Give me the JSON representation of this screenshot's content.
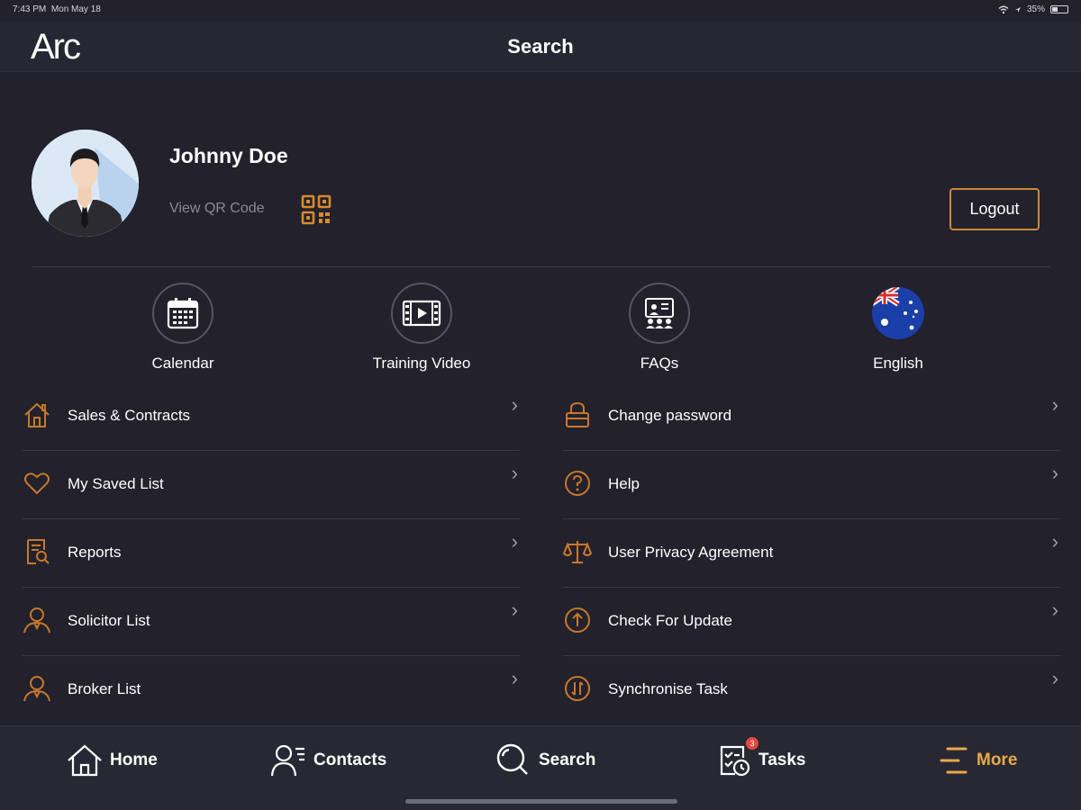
{
  "status_bar": {
    "time": "7:43 PM",
    "date": "Mon May 18",
    "battery": "35%"
  },
  "app": {
    "logo": "Arc",
    "title": "Search"
  },
  "profile": {
    "name": "Johnny Doe",
    "qr_label": "View QR Code",
    "logout_label": "Logout"
  },
  "quick_actions": [
    {
      "label": "Calendar",
      "icon": "calendar-icon"
    },
    {
      "label": "Training Video",
      "icon": "video-icon"
    },
    {
      "label": "FAQs",
      "icon": "faq-icon"
    },
    {
      "label": "English",
      "icon": "australia-flag-icon"
    }
  ],
  "menu_left": [
    {
      "label": "Sales & Contracts",
      "icon": "house-icon"
    },
    {
      "label": "My Saved List",
      "icon": "heart-icon"
    },
    {
      "label": "Reports",
      "icon": "report-icon"
    },
    {
      "label": "Solicitor List",
      "icon": "person-icon"
    },
    {
      "label": "Broker List",
      "icon": "person-icon"
    }
  ],
  "menu_right": [
    {
      "label": "Change password",
      "icon": "lock-icon"
    },
    {
      "label": "Help",
      "icon": "question-icon"
    },
    {
      "label": "User Privacy Agreement",
      "icon": "scales-icon"
    },
    {
      "label": "Check For Update",
      "icon": "upload-icon"
    },
    {
      "label": "Synchronise Task",
      "icon": "sync-icon"
    }
  ],
  "tabs": [
    {
      "label": "Home",
      "icon": "home-icon"
    },
    {
      "label": "Contacts",
      "icon": "contacts-icon"
    },
    {
      "label": "Search",
      "icon": "search-icon"
    },
    {
      "label": "Tasks",
      "icon": "tasks-icon",
      "badge": "3"
    },
    {
      "label": "More",
      "icon": "more-icon",
      "active": true
    }
  ],
  "colors": {
    "accent": "#e8a849",
    "background": "#22212c",
    "icon_orange": "#c8782c"
  }
}
